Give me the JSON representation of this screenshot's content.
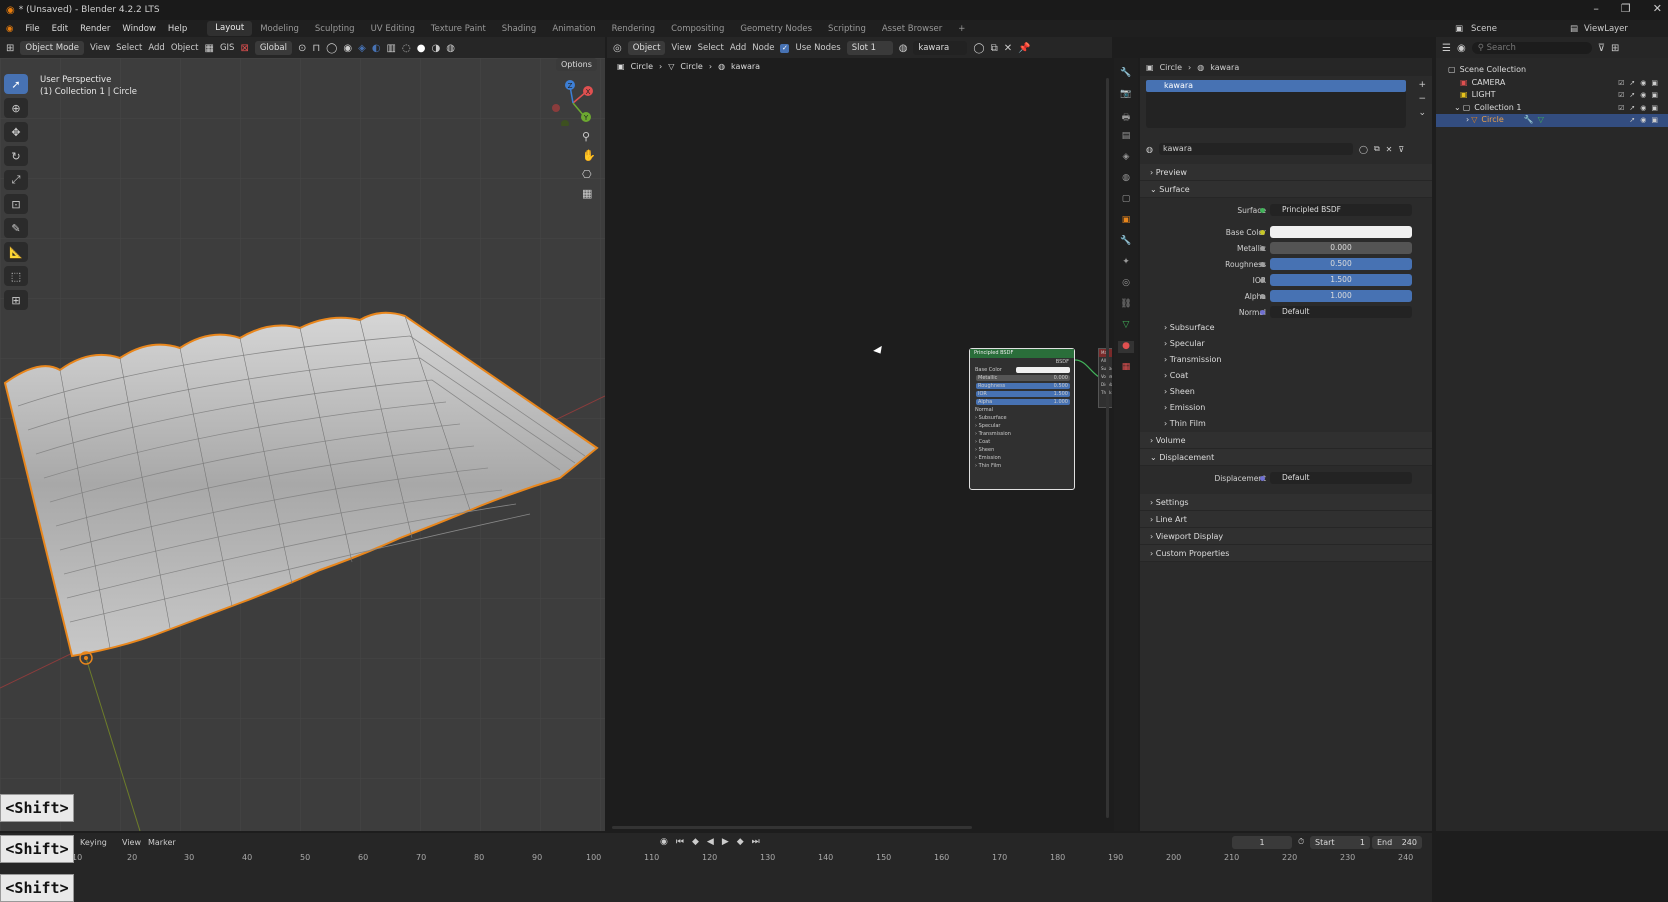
{
  "window": {
    "title": "* (Unsaved) - Blender 4.2.2 LTS",
    "controls": [
      "–",
      "❐",
      "✕"
    ]
  },
  "menubar": {
    "menus": [
      "File",
      "Edit",
      "Render",
      "Window",
      "Help"
    ],
    "workspaces": [
      "Layout",
      "Modeling",
      "Sculpting",
      "UV Editing",
      "Texture Paint",
      "Shading",
      "Animation",
      "Rendering",
      "Compositing",
      "Geometry Nodes",
      "Scripting",
      "Asset Browser"
    ],
    "active_workspace": "Layout",
    "add_workspace": "+",
    "scene": "Scene",
    "view_layer": "ViewLayer"
  },
  "viewport_header": {
    "mode": "Object Mode",
    "menus": [
      "View",
      "Select",
      "Add",
      "Object"
    ],
    "gis": "GIS",
    "transform": "Global",
    "options": "Options"
  },
  "viewport": {
    "perspective": "User Perspective",
    "collection_info": "(1) Collection 1 | Circle",
    "gizmo": {
      "x": "X",
      "y": "Y",
      "z": "Z"
    }
  },
  "node_editor": {
    "header": {
      "type": "Object",
      "menus": [
        "View",
        "Select",
        "Add",
        "Node"
      ],
      "use_nodes": "Use Nodes",
      "slot": "Slot 1",
      "material": "kawara"
    },
    "breadcrumb": [
      "Circle",
      "Circle",
      "kawara"
    ],
    "node": {
      "title": "Principled BSDF",
      "output": "BSDF",
      "rows": [
        {
          "label": "Base Color",
          "value": ""
        },
        {
          "label": "Metallic",
          "value": "0.000"
        },
        {
          "label": "Roughness",
          "value": "0.500"
        },
        {
          "label": "IOR",
          "value": "1.500"
        },
        {
          "label": "Alpha",
          "value": "1.000"
        }
      ],
      "normal": "Normal",
      "panels": [
        "Subsurface",
        "Specular",
        "Transmission",
        "Coat",
        "Sheen",
        "Emission",
        "Thin Film"
      ]
    },
    "output_node": {
      "title": "Ma",
      "target": "All",
      "sockets": [
        "Surface",
        "Volume",
        "Displace",
        "Thickn"
      ]
    }
  },
  "properties": {
    "breadcrumb": [
      "Circle",
      "kawara"
    ],
    "slot_item": "kawara",
    "material_name": "kawara",
    "panels": {
      "preview": "Preview",
      "surface": "Surface",
      "volume": "Volume",
      "displacement": "Displacement",
      "settings": "Settings",
      "line_art": "Line Art",
      "viewport_display": "Viewport Display",
      "custom_properties": "Custom Properties"
    },
    "surface": {
      "surface_label": "Surface",
      "surface_value": "Principled BSDF",
      "base_color_label": "Base Color",
      "metallic_label": "Metallic",
      "metallic_value": "0.000",
      "roughness_label": "Roughness",
      "roughness_value": "0.500",
      "ior_label": "IOR",
      "ior_value": "1.500",
      "alpha_label": "Alpha",
      "alpha_value": "1.000",
      "normal_label": "Normal",
      "normal_value": "Default",
      "base_color_hex": "#f0f0f0"
    },
    "subpanels": [
      "Subsurface",
      "Specular",
      "Transmission",
      "Coat",
      "Sheen",
      "Emission",
      "Thin Film"
    ],
    "displacement": {
      "label": "Displacement",
      "value": "Default"
    }
  },
  "outliner": {
    "search_placeholder": "Search",
    "items": [
      {
        "label": "Scene Collection"
      },
      {
        "label": "CAMERA"
      },
      {
        "label": "LIGHT"
      },
      {
        "label": "Collection 1"
      },
      {
        "label": "Circle"
      }
    ]
  },
  "timeline": {
    "menus": [
      "Keying",
      "View",
      "Marker"
    ],
    "current_frame": "1",
    "start_label": "Start",
    "start_value": "1",
    "end_label": "End",
    "end_value": "240",
    "ruler": [
      "10",
      "20",
      "30",
      "40",
      "50",
      "60",
      "70",
      "80",
      "90",
      "100",
      "110",
      "120",
      "130",
      "140",
      "150",
      "160",
      "170",
      "180",
      "190",
      "200",
      "210",
      "220",
      "230",
      "240"
    ]
  },
  "key_overlays": [
    "<Shift>",
    "<Shift>",
    "<Shift>"
  ]
}
